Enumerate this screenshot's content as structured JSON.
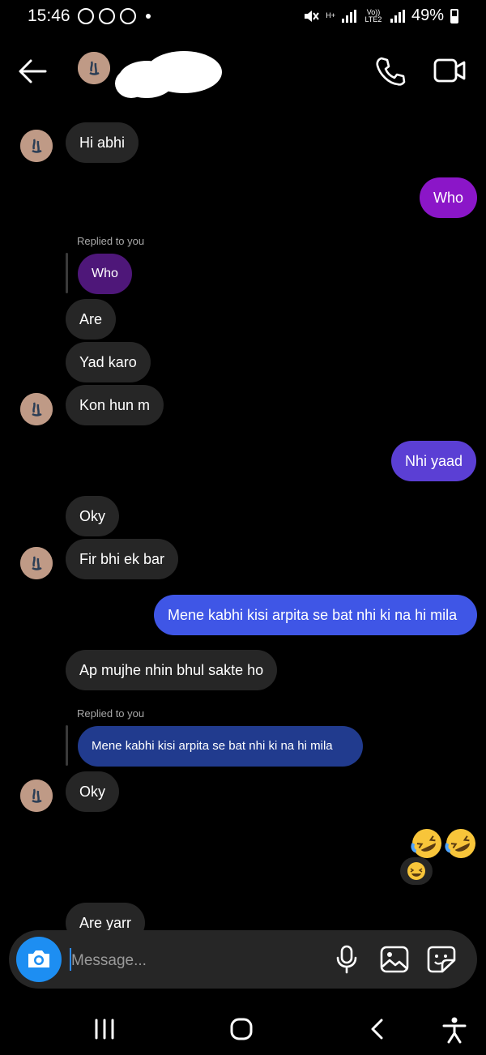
{
  "status_bar": {
    "time": "15:46",
    "battery": "49%",
    "network": "H+",
    "volte": "Vo)) LTE2"
  },
  "header": {
    "contact_name_redacted": true
  },
  "messages": [
    {
      "side": "in",
      "text": "Hi abhi"
    },
    {
      "side": "out",
      "text": "Who"
    },
    {
      "replied_label": "Replied to you",
      "reply_to": "Who"
    },
    {
      "side": "in",
      "text": "Are"
    },
    {
      "side": "in",
      "text": "Yad karo"
    },
    {
      "side": "in",
      "text": "Kon hun m"
    },
    {
      "side": "out",
      "text": "Nhi yaad"
    },
    {
      "side": "in",
      "text": "Oky"
    },
    {
      "side": "in",
      "text": "Fir bhi ek bar"
    },
    {
      "side": "out",
      "text": "Mene kabhi kisi arpita se bat nhi ki na hi mila"
    },
    {
      "side": "in",
      "text": "Ap mujhe nhin bhul sakte ho"
    },
    {
      "replied_label": "Replied to you",
      "reply_to": "Mene kabhi kisi arpita se bat nhi ki na hi mila"
    },
    {
      "side": "in",
      "text": "Oky"
    },
    {
      "side": "out",
      "emoji": "rolling-on-floor-laughing x2",
      "reaction": "grinning-squinting-face"
    },
    {
      "side": "in",
      "text": "Are yarr"
    }
  ],
  "composer": {
    "placeholder": "Message..."
  },
  "colors": {
    "background": "#000000",
    "incoming_bubble": "#262626",
    "outgoing_purple": "#8b16c8",
    "outgoing_indigo": "#5b3fd4",
    "outgoing_blue": "#3f56e6",
    "camera_button": "#1d8ef2"
  }
}
